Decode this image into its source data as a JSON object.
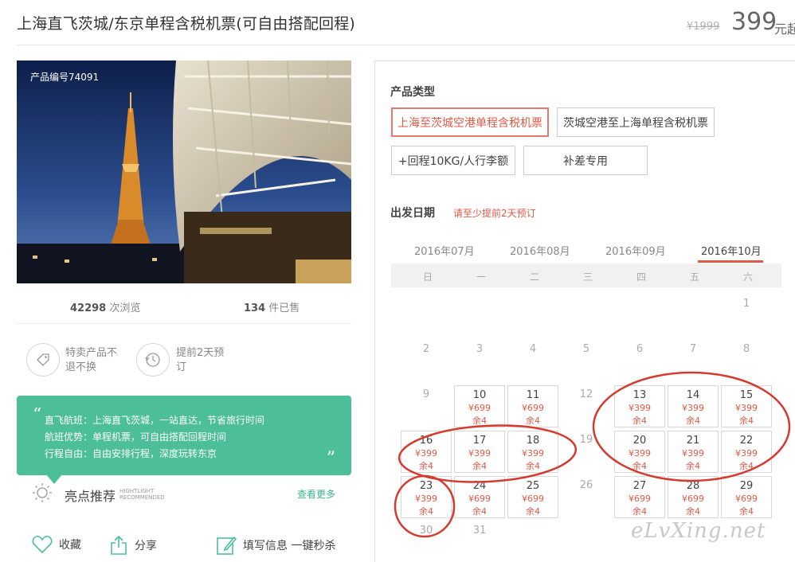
{
  "header": {
    "title": "上海直飞茨城/东京单程含税机票(可自由搭配回程)",
    "old_price": "¥1999",
    "price": "399",
    "price_unit": "元起"
  },
  "product": {
    "number_label": "产品编号74091",
    "views_count": "42298",
    "views_label": " 次浏览",
    "sold_count": "134",
    "sold_label": " 件已售"
  },
  "features": [
    {
      "text": "特卖产品不退不换",
      "icon": "tag-icon"
    },
    {
      "text": "提前2天预订",
      "icon": "clock-history-icon"
    }
  ],
  "intro": {
    "lines": [
      "直飞航班：上海直飞茨城，一站直达，节省旅行时间",
      "航班优势：单程机票，可自由搭配回程时间",
      "行程自由：自由安排行程，深度玩转东京"
    ]
  },
  "highlight": {
    "title": "亮点推荐",
    "en_line1": "HIGHTLIGHT",
    "en_line2": "RECOMMENDED",
    "more": "查看更多"
  },
  "bottom_actions": {
    "favorite": "收藏",
    "share": "分享",
    "fill_info": "填写信息 一键秒杀"
  },
  "booking": {
    "product_type_label": "产品类型",
    "options": [
      "上海至茨城空港单程含税机票",
      "茨城空港至上海单程含税机票",
      "+回程10KG/人行李额",
      "补差专用"
    ],
    "selected_option": 0,
    "date_label": "出发日期",
    "notice": "请至少提前2天预订"
  },
  "calendar": {
    "months": [
      "2016年07月",
      "2016年08月",
      "2016年09月",
      "2016年10月"
    ],
    "active_month": 3,
    "weekdays": [
      "日",
      "一",
      "二",
      "三",
      "四",
      "五",
      "六"
    ],
    "days": [
      {
        "d": "1"
      },
      {
        "d": "2"
      },
      {
        "d": "3"
      },
      {
        "d": "4"
      },
      {
        "d": "5"
      },
      {
        "d": "6"
      },
      {
        "d": "7"
      },
      {
        "d": "8"
      },
      {
        "d": "9"
      },
      {
        "d": "10",
        "price": "¥699",
        "rem": "余4"
      },
      {
        "d": "11",
        "price": "¥699",
        "rem": "余4"
      },
      {
        "d": "12"
      },
      {
        "d": "13",
        "price": "¥399",
        "rem": "余4"
      },
      {
        "d": "14",
        "price": "¥399",
        "rem": "余4"
      },
      {
        "d": "15",
        "price": "¥399",
        "rem": "余4"
      },
      {
        "d": "16",
        "price": "¥399",
        "rem": "余4"
      },
      {
        "d": "17",
        "price": "¥399",
        "rem": "余4"
      },
      {
        "d": "18",
        "price": "¥399",
        "rem": "余4"
      },
      {
        "d": "19"
      },
      {
        "d": "20",
        "price": "¥399",
        "rem": "余4"
      },
      {
        "d": "21",
        "price": "¥399",
        "rem": "余4"
      },
      {
        "d": "22",
        "price": "¥399",
        "rem": "余4"
      },
      {
        "d": "23",
        "price": "¥399",
        "rem": "余4"
      },
      {
        "d": "24",
        "price": "¥699",
        "rem": "余4"
      },
      {
        "d": "25",
        "price": "¥699",
        "rem": "余4"
      },
      {
        "d": "26"
      },
      {
        "d": "27",
        "price": "¥699",
        "rem": "余4"
      },
      {
        "d": "28",
        "price": "¥699",
        "rem": "余4"
      },
      {
        "d": "29",
        "price": "¥699",
        "rem": "余4"
      },
      {
        "d": "30"
      },
      {
        "d": "31"
      }
    ]
  },
  "watermark": "eLvXing.net",
  "colors": {
    "accent_red": "#e05a48",
    "green": "#4cbf98"
  }
}
